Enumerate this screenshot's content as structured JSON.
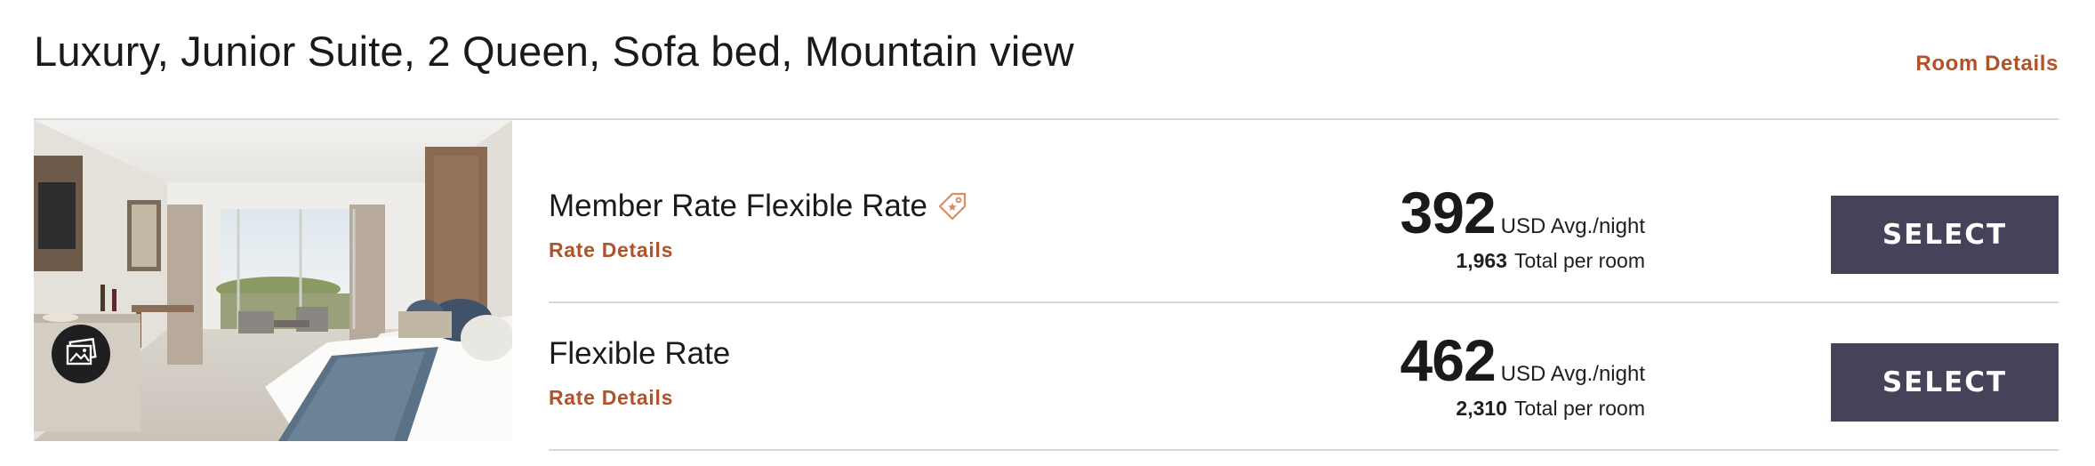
{
  "room": {
    "title": "Luxury, Junior Suite, 2 Queen, Sofa bed, Mountain view",
    "details_link": "Room Details",
    "gallery_icon": "gallery-icon"
  },
  "rates": [
    {
      "name": "Member Rate Flexible Rate",
      "badge_icon": "member-tag-icon",
      "details_link": "Rate Details",
      "avg_price": "392",
      "avg_label": "USD Avg./night",
      "total_price": "1,963",
      "total_label": "Total per room",
      "select_label": "SELECT"
    },
    {
      "name": "Flexible Rate",
      "details_link": "Rate Details",
      "avg_price": "462",
      "avg_label": "USD Avg./night",
      "total_price": "2,310",
      "total_label": "Total per room",
      "select_label": "SELECT"
    }
  ],
  "colors": {
    "accent": "#b0532a",
    "button": "#45435a",
    "divider": "#d8d8d8"
  }
}
